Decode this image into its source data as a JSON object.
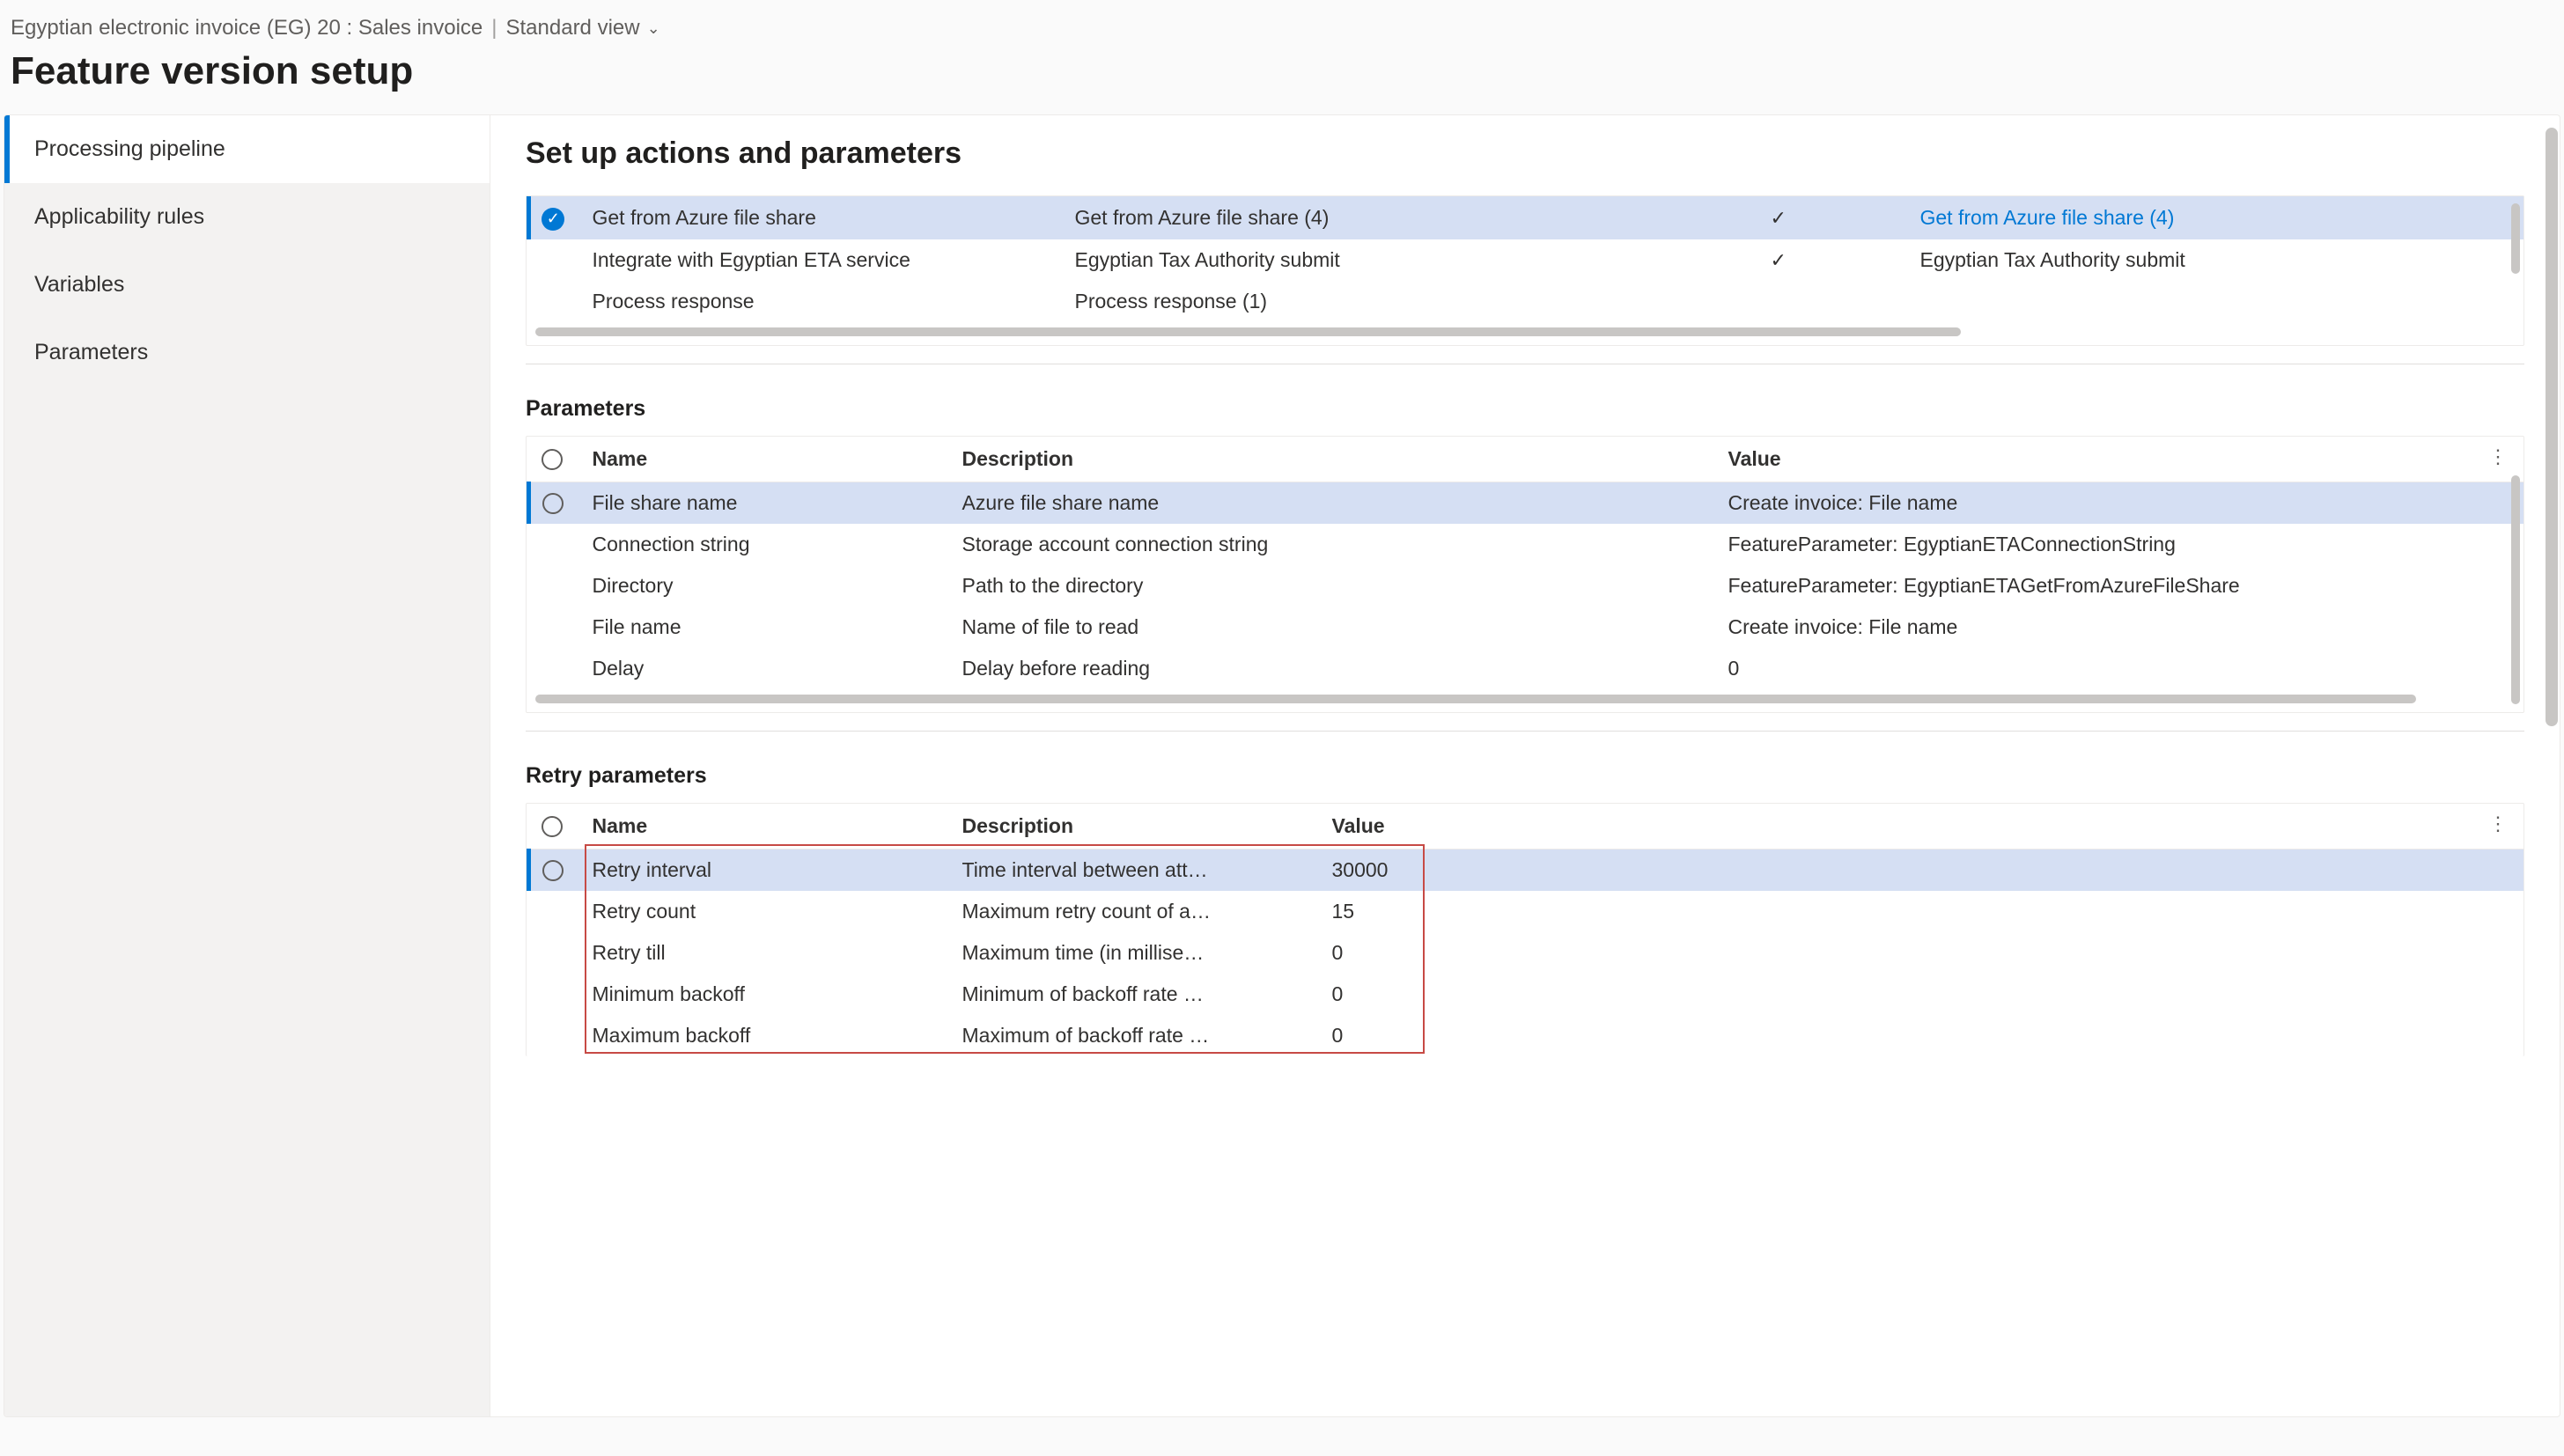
{
  "breadcrumb": {
    "path": "Egyptian electronic invoice (EG) 20 : Sales invoice",
    "view": "Standard view"
  },
  "page_title": "Feature version setup",
  "sidebar": {
    "items": [
      {
        "label": "Processing pipeline",
        "active": true
      },
      {
        "label": "Applicability rules",
        "active": false
      },
      {
        "label": "Variables",
        "active": false
      },
      {
        "label": "Parameters",
        "active": false
      }
    ]
  },
  "actions": {
    "title": "Set up actions and parameters",
    "rows": [
      {
        "selected": true,
        "action": "Get from Azure file share",
        "action_name": "Get from Azure file share (4)",
        "enabled": true,
        "link": "Get from Azure file share (4)"
      },
      {
        "selected": false,
        "action": "Integrate with Egyptian ETA service",
        "action_name": "Egyptian Tax Authority submit",
        "enabled": true,
        "link": "Egyptian Tax Authority submit"
      },
      {
        "selected": false,
        "action": "Process response",
        "action_name": "Process response (1)",
        "enabled": false,
        "link": ""
      }
    ]
  },
  "parameters": {
    "title": "Parameters",
    "headers": {
      "name": "Name",
      "description": "Description",
      "value": "Value"
    },
    "rows": [
      {
        "selected": true,
        "name": "File share name",
        "description": "Azure file share name",
        "value": "Create invoice: File name"
      },
      {
        "selected": false,
        "name": "Connection string",
        "description": "Storage account connection string",
        "value": "FeatureParameter: EgyptianETAConnectionString"
      },
      {
        "selected": false,
        "name": "Directory",
        "description": "Path to the directory",
        "value": "FeatureParameter: EgyptianETAGetFromAzureFileShare"
      },
      {
        "selected": false,
        "name": "File name",
        "description": "Name of file to read",
        "value": "Create invoice: File name"
      },
      {
        "selected": false,
        "name": "Delay",
        "description": "Delay before reading",
        "value": "0"
      }
    ]
  },
  "retry": {
    "title": "Retry parameters",
    "headers": {
      "name": "Name",
      "description": "Description",
      "value": "Value"
    },
    "rows": [
      {
        "selected": true,
        "name": "Retry interval",
        "description": "Time interval between att…",
        "value": "30000"
      },
      {
        "selected": false,
        "name": "Retry count",
        "description": "Maximum retry count of a…",
        "value": "15"
      },
      {
        "selected": false,
        "name": "Retry till",
        "description": "Maximum time (in millise…",
        "value": "0"
      },
      {
        "selected": false,
        "name": "Minimum backoff",
        "description": "Minimum of backoff rate …",
        "value": "0"
      },
      {
        "selected": false,
        "name": "Maximum backoff",
        "description": "Maximum of backoff rate …",
        "value": "0"
      }
    ]
  }
}
